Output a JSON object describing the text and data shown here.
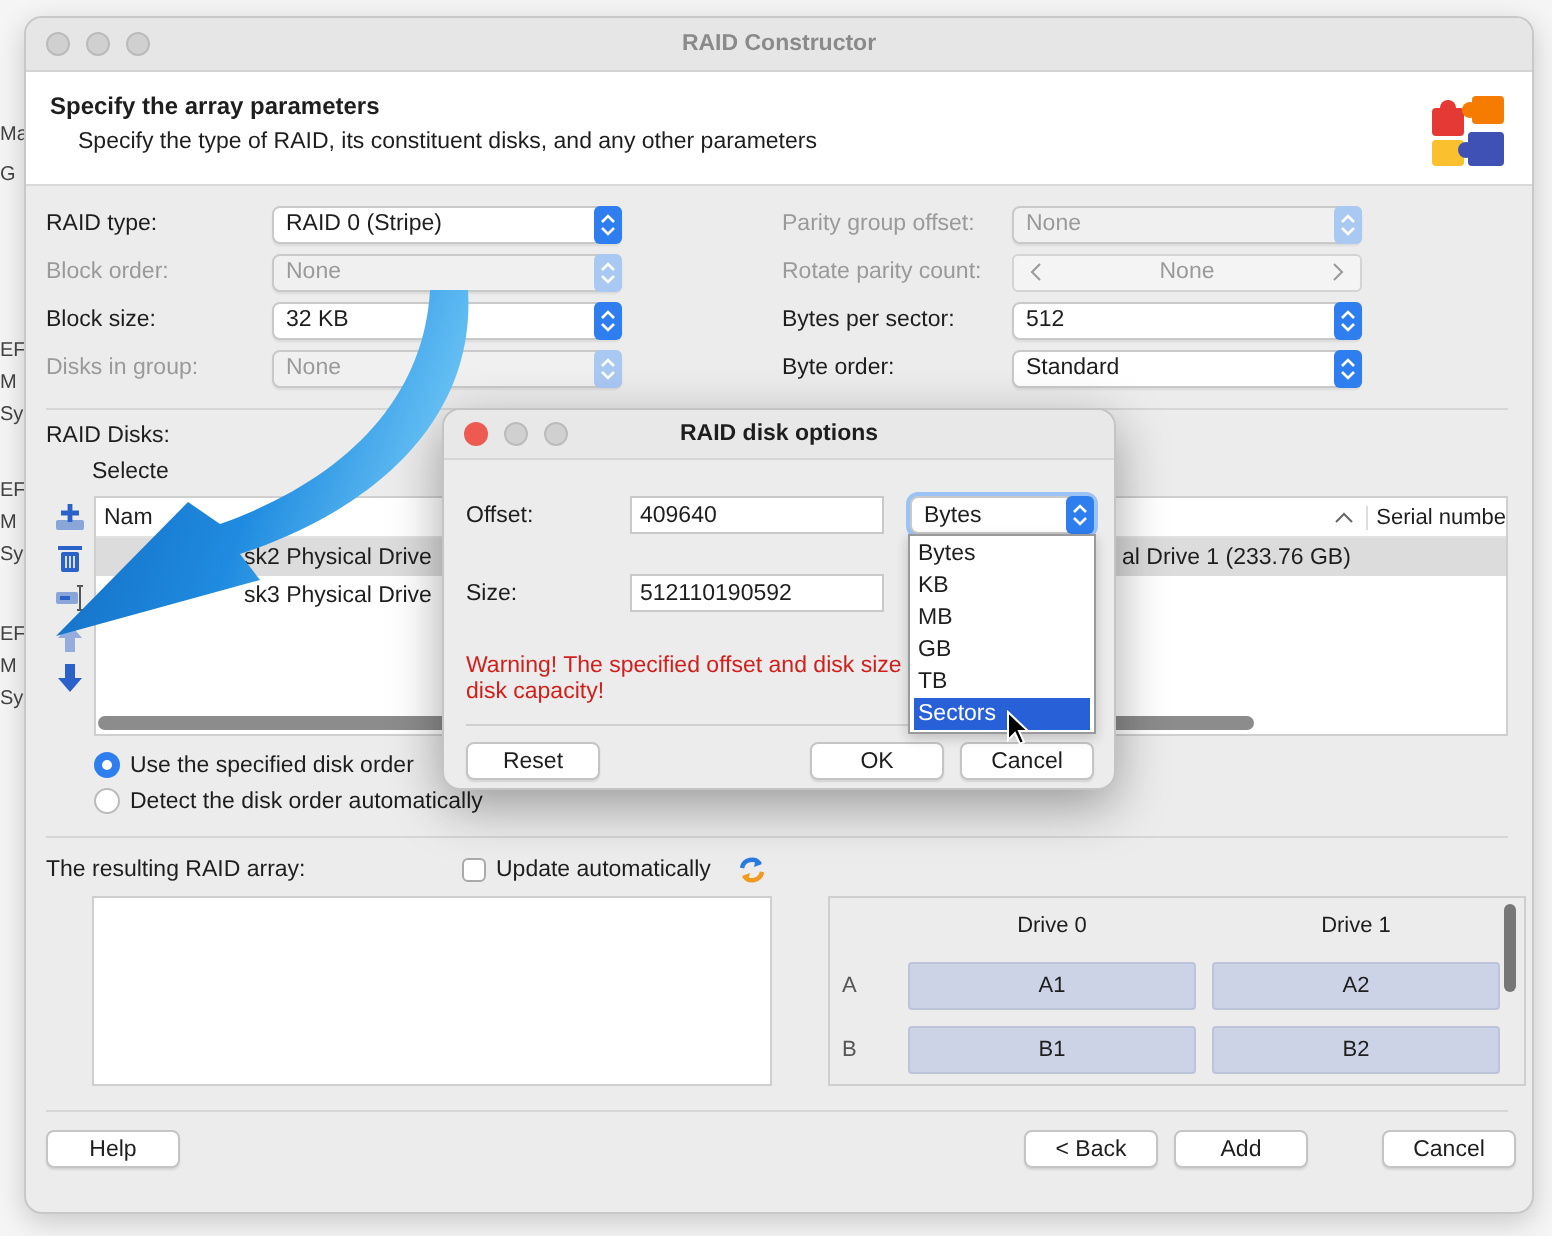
{
  "background_window": {
    "fragments": [
      "Ma",
      "G",
      "EF",
      "M",
      "Sy",
      "EF",
      "M",
      "Sy",
      "EF",
      "M",
      "Sy"
    ]
  },
  "window": {
    "title": "RAID Constructor"
  },
  "header": {
    "title": "Specify the array parameters",
    "subtitle": "Specify the type of RAID, its constituent disks, and any other parameters"
  },
  "parameters": {
    "left": [
      {
        "label": "RAID type:",
        "value": "RAID 0 (Stripe)",
        "kind": "select",
        "disabled": false
      },
      {
        "label": "Block order:",
        "value": "None",
        "kind": "select",
        "disabled": true
      },
      {
        "label": "Block size:",
        "value": "32 KB",
        "kind": "select",
        "disabled": false
      },
      {
        "label": "Disks in group:",
        "value": "None",
        "kind": "select",
        "disabled": true
      }
    ],
    "right": [
      {
        "label": "Parity group offset:",
        "value": "None",
        "kind": "select",
        "disabled": true
      },
      {
        "label": "Rotate parity count:",
        "value": "None",
        "kind": "stepper",
        "disabled": true
      },
      {
        "label": "Bytes per sector:",
        "value": "512",
        "kind": "select",
        "disabled": false
      },
      {
        "label": "Byte order:",
        "value": "Standard",
        "kind": "select",
        "disabled": false
      }
    ]
  },
  "raid_disks": {
    "label": "RAID Disks:",
    "selected_label": "Selecte",
    "tools": [
      {
        "kind": "add",
        "disabled": false
      },
      {
        "kind": "delete",
        "disabled": false
      },
      {
        "kind": "options",
        "disabled": false
      },
      {
        "kind": "up",
        "disabled": true
      },
      {
        "kind": "down",
        "disabled": false
      }
    ],
    "list": {
      "columns": [
        "Nam",
        "Serial numbe"
      ],
      "rows": [
        {
          "name_start": "sk2 Physical Drive",
          "name_end": "al Drive 1 (233.76 GB)",
          "selected": true
        },
        {
          "name_start": "sk3 Physical Drive",
          "selected": false
        }
      ]
    },
    "order_options": [
      {
        "label": "Use the specified disk order",
        "selected": true
      },
      {
        "label": "Detect the disk order automatically",
        "selected": false
      }
    ]
  },
  "result": {
    "label": "The resulting RAID array:",
    "update_automatically": {
      "label": "Update automatically",
      "checked": false
    },
    "layout": {
      "drives": [
        "Drive 0",
        "Drive 1"
      ],
      "rows": [
        {
          "label": "A",
          "cells": [
            "A1",
            "A2"
          ]
        },
        {
          "label": "B",
          "cells": [
            "B1",
            "B2"
          ]
        }
      ]
    }
  },
  "buttons": [
    {
      "label": "Help"
    },
    {
      "label": "< Back"
    },
    {
      "label": "Add"
    },
    {
      "label": "Cancel"
    }
  ],
  "dialog": {
    "title": "RAID disk options",
    "fields": [
      {
        "label": "Offset:",
        "value": "409640",
        "unit": "Bytes"
      },
      {
        "label": "Size:",
        "value": "512110190592"
      }
    ],
    "unit_menu": {
      "options": [
        {
          "label": "Bytes",
          "selected": false
        },
        {
          "label": "KB",
          "selected": false
        },
        {
          "label": "MB",
          "selected": false
        },
        {
          "label": "GB",
          "selected": false
        },
        {
          "label": "TB",
          "selected": false
        },
        {
          "label": "Sectors",
          "selected": true
        }
      ]
    },
    "warning": [
      "Warning! The specified offset and disk size",
      "disk capacity!"
    ],
    "buttons": [
      "Reset",
      "OK",
      "Cancel"
    ]
  }
}
